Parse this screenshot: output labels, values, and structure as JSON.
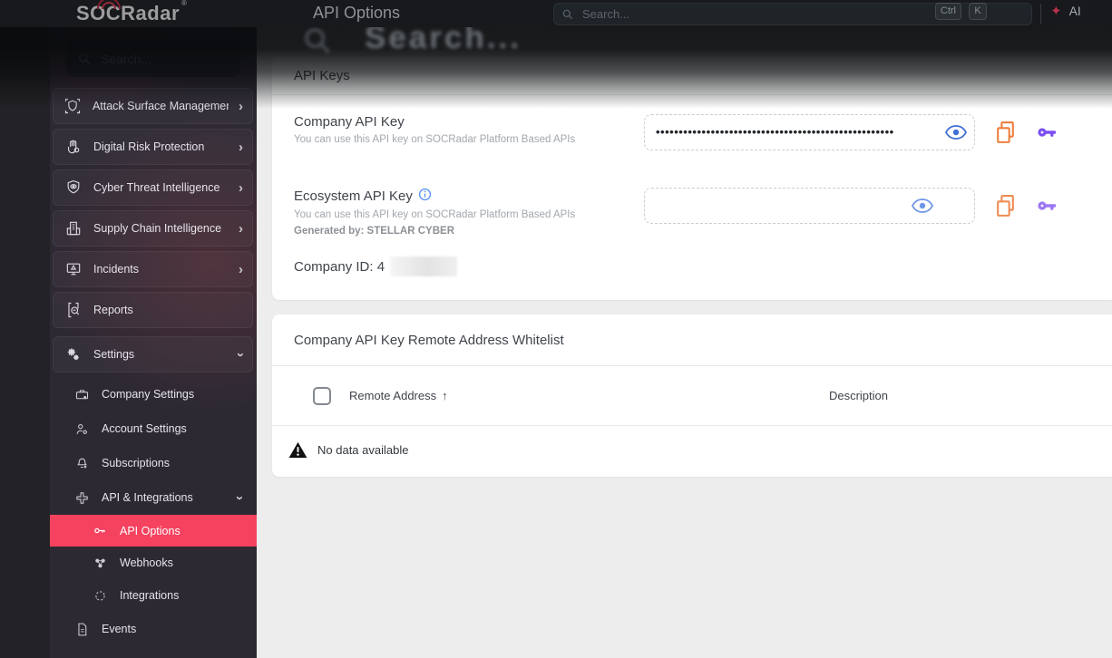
{
  "header": {
    "logo_text": "SOCRadar",
    "logo_reg": "®",
    "page_title": "API Options",
    "search_placeholder": "Search...",
    "shortcut_ctrl": "Ctrl",
    "shortcut_k": "K",
    "ai_label": "AI",
    "ghost_search_text": "Search..."
  },
  "sidebar": {
    "search_placeholder": "Search...",
    "items": [
      {
        "label": "Attack Surface Management",
        "chevron": "›"
      },
      {
        "label": "Digital Risk Protection",
        "chevron": "›"
      },
      {
        "label": "Cyber Threat Intelligence",
        "chevron": "›"
      },
      {
        "label": "Supply Chain Intelligence",
        "chevron": "›"
      },
      {
        "label": "Incidents",
        "chevron": "›"
      },
      {
        "label": "Reports",
        "chevron": ""
      },
      {
        "label": "Settings",
        "chevron": "›"
      },
      {
        "label": "Company Settings"
      },
      {
        "label": "Account Settings"
      },
      {
        "label": "Subscriptions"
      },
      {
        "label": "API & Integrations",
        "chevron": "›"
      },
      {
        "label": "API Options",
        "active": true
      },
      {
        "label": "Webhooks"
      },
      {
        "label": "Integrations"
      },
      {
        "label": "Events"
      }
    ]
  },
  "api_keys_card": {
    "title": "API Keys",
    "company_key": {
      "label": "Company API Key",
      "description": "You can use this API key on SOCRadar Platform Based APIs",
      "masked_value": "••••••••••••••••••••••••••••••••••••••••••••••••••••"
    },
    "ecosystem_key": {
      "label": "Ecosystem API Key",
      "description": "You can use this API key on SOCRadar Platform Based APIs",
      "generated_by": "Generated by: STELLAR CYBER",
      "value": ""
    },
    "company_id_label": "Company ID: 4"
  },
  "whitelist_card": {
    "title": "Company API Key Remote Address Whitelist",
    "columns": [
      "Remote Address",
      "Description"
    ],
    "sort_arrow": "↑",
    "empty_text": "No data available"
  },
  "colors": {
    "accent_pink": "#f4425f",
    "icon_orange": "#ee7f3e",
    "icon_purple": "#7b4ff2",
    "icon_purple_light": "#9b77f6",
    "icon_blue": "#4a78d8",
    "info_blue": "#4c8bf5"
  }
}
